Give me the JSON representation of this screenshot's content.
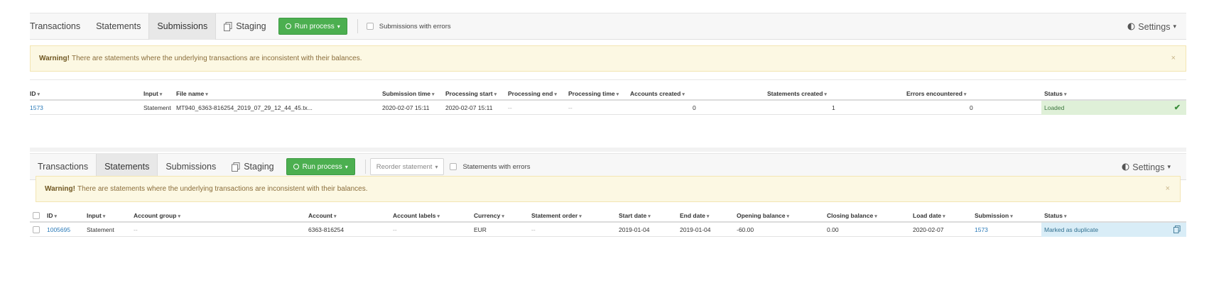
{
  "panel1": {
    "tabs": [
      "Transactions",
      "Statements",
      "Submissions"
    ],
    "staging": "Staging",
    "run_process": "Run process",
    "checkbox_label": "Submissions with errors",
    "settings": "Settings",
    "warning_bold": "Warning!",
    "warning_text": "There are statements where the underlying transactions are inconsistent with their balances.",
    "close": "×",
    "headers": [
      "ID",
      "Input",
      "File name",
      "Submission time",
      "Processing start",
      "Processing end",
      "Processing time",
      "Accounts created",
      "Statements created",
      "Errors encountered",
      "Status"
    ],
    "row": {
      "id": "1573",
      "input": "Statement",
      "file_name": "MT940_6363-816254_2019_07_29_12_44_45.tx...",
      "submission_time": "2020-02-07 15:11",
      "processing_start": "2020-02-07 15:11",
      "processing_end": "--",
      "processing_time": "--",
      "accounts_created": "0",
      "statements_created": "1",
      "errors_encountered": "0",
      "status": "Loaded"
    }
  },
  "panel2": {
    "tabs": [
      "Transactions",
      "Statements",
      "Submissions"
    ],
    "staging": "Staging",
    "run_process": "Run process",
    "reorder": "Reorder statement",
    "checkbox_label": "Statements with errors",
    "settings": "Settings",
    "warning_bold": "Warning!",
    "warning_text": "There are statements where the underlying transactions are inconsistent with their balances.",
    "close": "×",
    "headers": [
      "ID",
      "Input",
      "Account group",
      "Account",
      "Account labels",
      "Currency",
      "Statement order",
      "Start date",
      "End date",
      "Opening balance",
      "Closing balance",
      "Load date",
      "Submission",
      "Status"
    ],
    "row": {
      "id": "1005695",
      "input": "Statement",
      "account_group": "--",
      "account": "6363-816254",
      "account_labels": "--",
      "currency": "EUR",
      "statement_order": "--",
      "start_date": "2019-01-04",
      "end_date": "2019-01-04",
      "opening_balance": "-60.00",
      "closing_balance": "0.00",
      "load_date": "2020-02-07",
      "submission": "1573",
      "status": "Marked as duplicate"
    }
  },
  "colors": {
    "accent_green": "#4caf50",
    "link": "#2a7ab8",
    "warning_bg": "#fcf8e3",
    "loaded_bg": "#dff0d8",
    "duplicate_bg": "#d9edf7"
  },
  "icons": {
    "staging": "copy-icon",
    "run": "play-circle-icon",
    "settings": "toggle-icon",
    "loaded": "checkmark-icon",
    "duplicate": "copy-icon"
  }
}
